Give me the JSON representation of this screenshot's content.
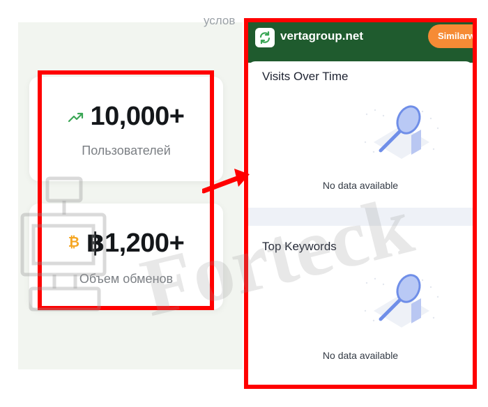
{
  "left_page": {
    "cut_heading": "услов",
    "stats": [
      {
        "value": "10,000+",
        "label": "Пользователей",
        "icon": "trend-up-icon"
      },
      {
        "value": "฿1,200+",
        "label": "Объем обменов",
        "icon": "bitcoin-icon"
      }
    ]
  },
  "widget": {
    "site_name": "vertagroup.net",
    "brand_button": "Similarw",
    "sections": [
      {
        "title": "Visits Over Time",
        "empty_text": "No data available"
      },
      {
        "title": "Top Keywords",
        "empty_text": "No data available"
      }
    ]
  },
  "watermark": {
    "text": "Forteck"
  },
  "colors": {
    "highlight": "#ff0000",
    "header_green": "#1f5b2e",
    "brand_orange": "#f68b35",
    "bitcoin_orange": "#f5a623",
    "trend_green": "#3aa655"
  }
}
